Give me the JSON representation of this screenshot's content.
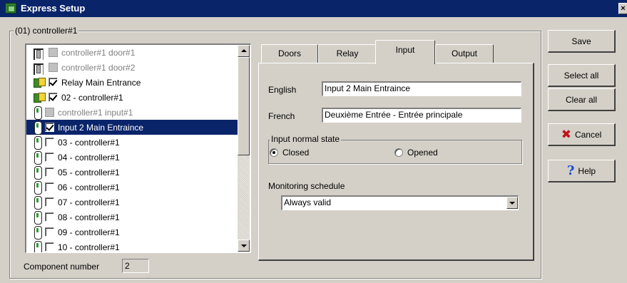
{
  "window": {
    "title": "Express Setup",
    "close_glyph": "×"
  },
  "group": {
    "label": "(01) controller#1"
  },
  "list": {
    "items": [
      {
        "icon": "door-icon",
        "checkbox": "disabled",
        "label": "controller#1 door#1"
      },
      {
        "icon": "door-icon",
        "checkbox": "disabled",
        "label": "controller#1 door#2"
      },
      {
        "icon": "relay-icon",
        "checkbox": "checked",
        "label": "Relay Main Entrance"
      },
      {
        "icon": "relay-icon",
        "checkbox": "checked",
        "label": "02 - controller#1"
      },
      {
        "icon": "input-icon",
        "checkbox": "disabled",
        "label": "controller#1 input#1"
      },
      {
        "icon": "input-icon",
        "checkbox": "checked",
        "label": "Input 2  Main Entraince"
      },
      {
        "icon": "input-icon",
        "checkbox": "unchecked",
        "label": "03 - controller#1"
      },
      {
        "icon": "input-icon",
        "checkbox": "unchecked",
        "label": "04 - controller#1"
      },
      {
        "icon": "input-icon",
        "checkbox": "unchecked",
        "label": "05 - controller#1"
      },
      {
        "icon": "input-icon",
        "checkbox": "unchecked",
        "label": "06 - controller#1"
      },
      {
        "icon": "input-icon",
        "checkbox": "unchecked",
        "label": "07 - controller#1"
      },
      {
        "icon": "input-icon",
        "checkbox": "unchecked",
        "label": "08 - controller#1"
      },
      {
        "icon": "input-icon",
        "checkbox": "unchecked",
        "label": "09 - controller#1"
      },
      {
        "icon": "input-icon",
        "checkbox": "unchecked",
        "label": "10 - controller#1"
      }
    ],
    "selected_index": 5
  },
  "component_number": {
    "label": "Component number",
    "value": "2"
  },
  "tabs": [
    {
      "label": "Doors",
      "active": false
    },
    {
      "label": "Relay",
      "active": false
    },
    {
      "label": "Input",
      "active": true
    },
    {
      "label": "Output",
      "active": false
    }
  ],
  "input_tab": {
    "english_label": "English",
    "english_value": "Input 2  Main Entraince",
    "french_label": "French",
    "french_value": "Deuxième Entrée - Entrée principale",
    "normal_state_label": "Input normal state",
    "closed_label": "Closed",
    "opened_label": "Opened",
    "selected_state": "Closed",
    "monitoring_label": "Monitoring schedule",
    "monitoring_value": "Always valid"
  },
  "buttons": {
    "save": "Save",
    "select_all": "Select all",
    "clear_all": "Clear all",
    "cancel": "Cancel",
    "help": "Help"
  },
  "icons": {
    "cancel": "x-icon",
    "help": "question-icon"
  },
  "colors": {
    "titlebar": "#0a246a",
    "selection": "#0a246a",
    "face": "#d4d0c8"
  }
}
